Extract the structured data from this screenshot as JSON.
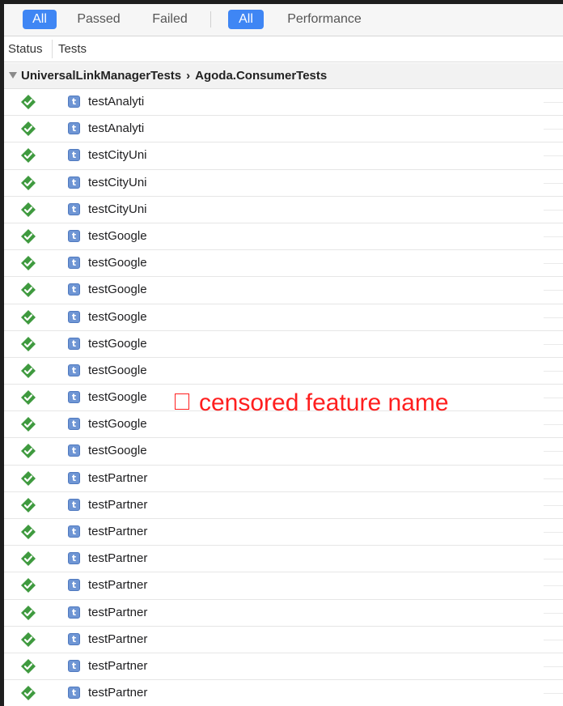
{
  "filter_bar": {
    "result_filters": [
      {
        "label": "All",
        "selected": true
      },
      {
        "label": "Passed",
        "selected": false
      },
      {
        "label": "Failed",
        "selected": false
      }
    ],
    "type_filters": [
      {
        "label": "All",
        "selected": true
      },
      {
        "label": "Performance",
        "selected": false
      }
    ]
  },
  "columns": {
    "status": "Status",
    "tests": "Tests"
  },
  "group": {
    "suite": "UniversalLinkManagerTests",
    "separator": "›",
    "target": "Agoda.ConsumerTests"
  },
  "test_badge_letter": "t",
  "tests": [
    {
      "name": "testAnalyti",
      "status": "passed"
    },
    {
      "name": "testAnalyti",
      "status": "passed"
    },
    {
      "name": "testCityUni",
      "status": "passed"
    },
    {
      "name": "testCityUni",
      "status": "passed"
    },
    {
      "name": "testCityUni",
      "status": "passed"
    },
    {
      "name": "testGoogle",
      "status": "passed"
    },
    {
      "name": "testGoogle",
      "status": "passed"
    },
    {
      "name": "testGoogle",
      "status": "passed"
    },
    {
      "name": "testGoogle",
      "status": "passed"
    },
    {
      "name": "testGoogle",
      "status": "passed"
    },
    {
      "name": "testGoogle",
      "status": "passed"
    },
    {
      "name": "testGoogle",
      "status": "passed"
    },
    {
      "name": "testGoogle",
      "status": "passed"
    },
    {
      "name": "testGoogle",
      "status": "passed"
    },
    {
      "name": "testPartner",
      "status": "passed"
    },
    {
      "name": "testPartner",
      "status": "passed"
    },
    {
      "name": "testPartner",
      "status": "passed"
    },
    {
      "name": "testPartner",
      "status": "passed"
    },
    {
      "name": "testPartner",
      "status": "passed"
    },
    {
      "name": "testPartner",
      "status": "passed"
    },
    {
      "name": "testPartner",
      "status": "passed"
    },
    {
      "name": "testPartner",
      "status": "passed"
    },
    {
      "name": "testPartner",
      "status": "passed"
    }
  ],
  "annotation": {
    "text": "censored feature name"
  },
  "colors": {
    "accent": "#3f86f4",
    "pass_green": "#3f9a3f",
    "annotation_red": "#ff1e1e"
  }
}
